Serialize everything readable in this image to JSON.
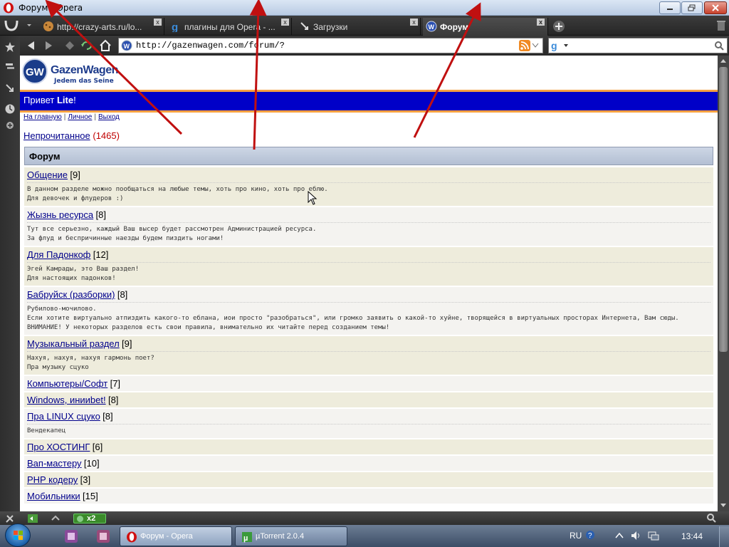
{
  "window": {
    "title": "Форум - Opera"
  },
  "tabs": [
    {
      "label": "http://crazy-arts.ru/lo...",
      "icon": "cookie-icon",
      "active": false
    },
    {
      "label": "плагины для Opera - ...",
      "icon": "google-icon",
      "active": false
    },
    {
      "label": "Загрузки",
      "icon": "download-icon",
      "active": false
    },
    {
      "label": "Форум",
      "icon": "gazenwagen-icon",
      "active": true
    }
  ],
  "address": {
    "url": "http://gazenwagen.com/forum/?"
  },
  "site": {
    "logo_name": "GazenWagen",
    "logo_tagline": "Jedem das Seine",
    "greeting_prefix": "Привет ",
    "greeting_user": "Lite",
    "greeting_suffix": "!",
    "nav_links": [
      "На главную",
      "Личное",
      "Выход"
    ],
    "unread_label": "Непрочитанное",
    "unread_count": "(1465)",
    "forum_heading": "Форум"
  },
  "forums": [
    {
      "name": "Общение",
      "count": "[9]",
      "desc": [
        "В данном разделе можно пообщаться на любые темы, хоть про кино, хоть про еблю.",
        "Для девочек и флудеров :)"
      ]
    },
    {
      "name": "Жызнь ресурса",
      "count": "[8]",
      "desc": [
        "Тут все серьезно, каждый Ваш высер будет рассмотрен Администрацией ресурса.",
        "За флуд и беспричинные наезды будем пиздить ногами!"
      ]
    },
    {
      "name": "Для Падонкоф",
      "count": "[12]",
      "desc": [
        "Эгей Камрады, это Ваш раздел!",
        "Для настоящих падонков!"
      ]
    },
    {
      "name": "Бабруйск (разборки)",
      "count": "[8]",
      "desc": [
        "Рубилово-мочилово.",
        "Если хотите виртуально атпиздить какого-то еблана, иои просто \"разобраться\", или громко заявить о какой-то хуйне, творящейся в виртуальных просторах Интернета, Вам сюды.",
        "ВНИМАНИЕ! У некоторых разделов есть свои правила, внимательно их читайте перед созданием темы!"
      ]
    },
    {
      "name": "Музыкальный раздел",
      "count": "[9]",
      "desc": [
        "Нахуя, нахуя, нахуя гармонь поет?",
        "Пра музыку сцуко"
      ]
    },
    {
      "name": "Компьютеры/Софт",
      "count": "[7]",
      "desc": []
    },
    {
      "name": "Windows, инииbet!",
      "count": "[8]",
      "desc": []
    },
    {
      "name": "Пра LINUX сцуко",
      "count": "[8]",
      "desc": [
        "Вендекапец"
      ]
    },
    {
      "name": "Про ХОСТИНГ",
      "count": "[6]",
      "desc": []
    },
    {
      "name": "Вап-мастеру",
      "count": "[10]",
      "desc": []
    },
    {
      "name": "PHP кодеру",
      "count": "[3]",
      "desc": []
    },
    {
      "name": "Мобильники",
      "count": "[15]",
      "desc": []
    }
  ],
  "statusbar": {
    "badge": "x2"
  },
  "taskbar": {
    "buttons": [
      {
        "label": "Форум - Opera",
        "icon": "opera-icon",
        "active": true
      },
      {
        "label": "µTorrent 2.0.4",
        "icon": "utorrent-icon",
        "active": false
      }
    ],
    "language": "RU",
    "clock": "13:44"
  },
  "colors": {
    "greeting_bar": "#0000c8",
    "accent_orange": "#f5a040",
    "link": "#00008b",
    "unread_count": "#c00000",
    "row_odd": "#eeecdc",
    "row_even": "#f4f3f0",
    "annotation_arrow": "#c01010"
  }
}
